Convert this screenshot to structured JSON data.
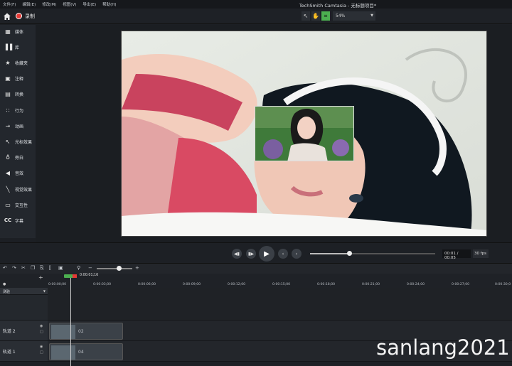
{
  "menu": {
    "items": [
      "文件(F)",
      "编辑(E)",
      "修改(M)",
      "视图(V)",
      "导出(E)",
      "帮助(H)"
    ],
    "window_title": "TechSmith Camtasia - 无标题项目*"
  },
  "toolbar": {
    "record_label": "录制",
    "zoom_value": "54%"
  },
  "sidebar": {
    "items": [
      {
        "label": "媒体",
        "icon": "media-icon"
      },
      {
        "label": "库",
        "icon": "library-icon"
      },
      {
        "label": "收藏夹",
        "icon": "star-icon"
      },
      {
        "label": "注释",
        "icon": "annotation-icon"
      },
      {
        "label": "转换",
        "icon": "transition-icon"
      },
      {
        "label": "行为",
        "icon": "behavior-icon"
      },
      {
        "label": "动画",
        "icon": "animation-icon"
      },
      {
        "label": "光标效果",
        "icon": "cursor-icon"
      },
      {
        "label": "旁白",
        "icon": "mic-icon"
      },
      {
        "label": "音效",
        "icon": "speaker-icon"
      },
      {
        "label": "视觉效果",
        "icon": "wand-icon"
      },
      {
        "label": "交互性",
        "icon": "interactive-icon"
      },
      {
        "label": "字幕",
        "icon": "cc-icon"
      }
    ]
  },
  "playback": {
    "timecode": "00:01 / 00:05",
    "fps": "30 fps",
    "progress": 0.31
  },
  "timeline": {
    "playhead_time": "0:00:01;16",
    "ruler_ticks": [
      "0:00:00;00",
      "0:00:03;00",
      "0:00:06;00",
      "0:00:09;00",
      "0:00:12;00",
      "0:00:15;00",
      "0:00:18;00",
      "0:00:21;00",
      "0:00:24;00",
      "0:00:27;00",
      "0:00:30;0"
    ],
    "marker_label": "测验",
    "tracks": [
      {
        "name": "轨道 2",
        "clip_label": "02"
      },
      {
        "name": "轨道 1",
        "clip_label": "04"
      }
    ]
  },
  "watermark": "sanlang2021"
}
